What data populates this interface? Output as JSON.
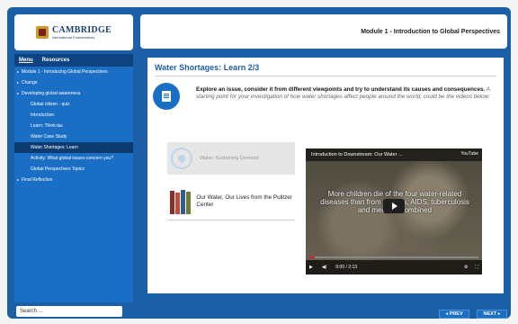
{
  "logo": {
    "name": "CAMBRIDGE",
    "sub": "International Examinations"
  },
  "menu": {
    "tabs": [
      "Menu",
      "Resources"
    ]
  },
  "sidebar": {
    "items": [
      {
        "label": "Module 1 - Introducing Global Perspectives",
        "level": 0,
        "selected": false
      },
      {
        "label": "Change",
        "level": 0,
        "selected": false
      },
      {
        "label": "Developing global awareness",
        "level": 0,
        "selected": false
      },
      {
        "label": "Global citizen - quiz",
        "level": 1,
        "selected": false
      },
      {
        "label": "Introduction",
        "level": 1,
        "selected": false
      },
      {
        "label": "Learn: Think-tac",
        "level": 1,
        "selected": false
      },
      {
        "label": "Water Case Study",
        "level": 1,
        "selected": false
      },
      {
        "label": "Water Shortages: Learn",
        "level": 1,
        "selected": true
      },
      {
        "label": "Activity: What global issues concern you?",
        "level": 1,
        "selected": false
      },
      {
        "label": "Global Perspectives Topics",
        "level": 1,
        "selected": false
      },
      {
        "label": "Final Reflection",
        "level": 0,
        "selected": false
      }
    ]
  },
  "search": {
    "placeholder": "Search ..."
  },
  "header": {
    "title": "Module 1 - Introduction to Global Perspectives"
  },
  "page": {
    "title": "Water Shortages: Learn 2/3",
    "intro_bold": "Explore an issue, consider it from different viewpoints and try to understand its causes and consequences.",
    "intro_italic": " A starting point for your investigation of how water shortages affect people around the world, could be the videos below:"
  },
  "cards": [
    {
      "label": "Water: Sustaining Demand",
      "icon": "water-drop-icon"
    },
    {
      "label": "Our Water, Our Lives from the Pulitzer Center",
      "icon": "books-icon"
    }
  ],
  "video": {
    "title": "Introduction to Downstream: Our Water ...",
    "badge": "YouTube",
    "caption": "More children die of the four water-related diseases than from malaria, AIDS, tuberculosis and measles combined",
    "time": "0:00 / 2:13",
    "progress": 0.03
  },
  "footer": {
    "prev": "◂ PREV",
    "next": "NEXT ▸"
  },
  "colors": {
    "brand_blue": "#1b5fa6",
    "sidebar_blue": "#1a6ec4",
    "selected": "#0d3b70"
  }
}
